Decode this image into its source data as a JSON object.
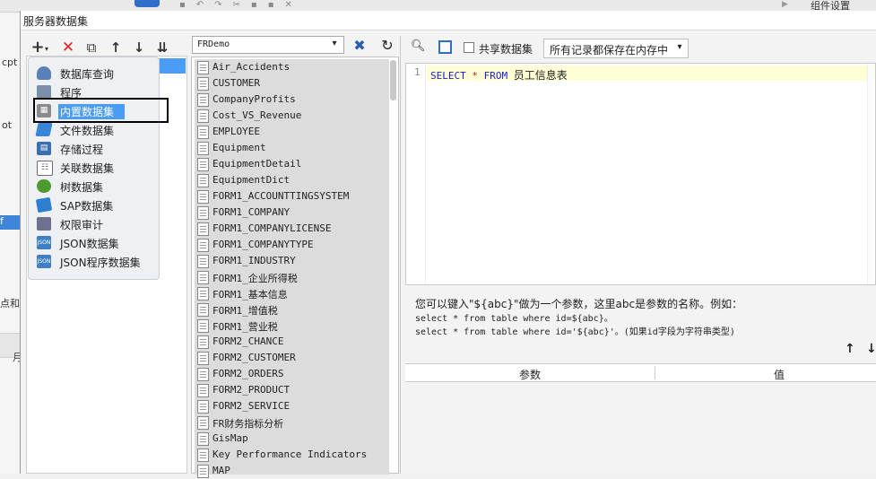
{
  "background_app": {
    "component_settings": "组件设置",
    "left_snippets": [
      "cpt",
      "ot",
      "f",
      "点和",
      "月"
    ]
  },
  "dialog": {
    "title": "服务器数据集"
  },
  "left_toolbar": {
    "icons": [
      "add-icon",
      "delete-icon",
      "copy-icon",
      "move-up-icon",
      "move-down-icon",
      "sort-icon"
    ]
  },
  "dataset_menu": {
    "items": [
      {
        "label": "数据库查询",
        "icon": "database-query-icon",
        "color": "#5b7fb8"
      },
      {
        "label": "程序",
        "icon": "program-icon",
        "color": "#7b8fa8"
      },
      {
        "label": "内置数据集",
        "icon": "builtin-dataset-icon",
        "color": "#8a8a8a",
        "selected": true
      },
      {
        "label": "文件数据集",
        "icon": "file-dataset-icon",
        "color": "#3a86d6"
      },
      {
        "label": "存储过程",
        "icon": "stored-procedure-icon",
        "color": "#3a6fb0"
      },
      {
        "label": "关联数据集",
        "icon": "related-dataset-icon",
        "color": "#6b6b6b"
      },
      {
        "label": "树数据集",
        "icon": "tree-dataset-icon",
        "color": "#4f9a2e"
      },
      {
        "label": "SAP数据集",
        "icon": "sap-dataset-icon",
        "color": "#2f7fd0"
      },
      {
        "label": "权限审计",
        "icon": "permission-audit-icon",
        "color": "#6f6f8f"
      },
      {
        "label": "JSON数据集",
        "icon": "json-dataset-icon",
        "color": "#3f7fc4"
      },
      {
        "label": "JSON程序数据集",
        "icon": "json-program-dataset-icon",
        "color": "#3f7fc4"
      }
    ]
  },
  "connection": {
    "selected": "FRDemo"
  },
  "tables": [
    "Air_Accidents",
    "CUSTOMER",
    "CompanyProfits",
    "Cost_VS_Revenue",
    "EMPLOYEE",
    "Equipment",
    "EquipmentDetail",
    "EquipmentDict",
    "FORM1_ACCOUNTTINGSYSTEM",
    "FORM1_COMPANY",
    "FORM1_COMPANYLICENSE",
    "FORM1_COMPANYTYPE",
    "FORM1_INDUSTRY",
    "FORM1_企业所得税",
    "FORM1_基本信息",
    "FORM1_增值税",
    "FORM1_营业税",
    "FORM2_CHANCE",
    "FORM2_CUSTOMER",
    "FORM2_ORDERS",
    "FORM2_PRODUCT",
    "FORM2_SERVICE",
    "FR财务指标分析",
    "GisMap",
    "Key Performance Indicators",
    "MAP"
  ],
  "sql_toolbar": {
    "share_label": "共享数据集",
    "memory_option": "所有记录都保存在内存中"
  },
  "editor": {
    "line_number": "1",
    "tokens": [
      {
        "text": "SELECT",
        "color": "#1a1ad0"
      },
      {
        "text": "*",
        "color": "#c02020"
      },
      {
        "text": "FROM",
        "color": "#1a1ad0"
      },
      {
        "text": "员工信息表",
        "color": "#222222"
      }
    ]
  },
  "help": {
    "line1": "您可以键入\"${abc}\"做为一个参数，这里abc是参数的名称。例如：",
    "line2": "select * from table where id=${abc}。",
    "line3": "select * from table where id='${abc}'。(如果id字段为字符串类型)"
  },
  "params": {
    "col_param": "参数",
    "col_value": "值"
  }
}
